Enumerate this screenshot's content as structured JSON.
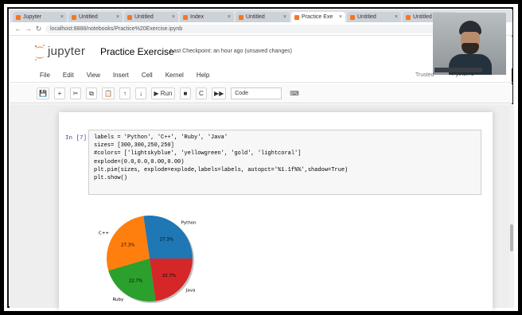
{
  "browser": {
    "tabs": [
      {
        "label": "Jupyter",
        "active": false
      },
      {
        "label": "Untitled",
        "active": false
      },
      {
        "label": "Untitled",
        "active": false
      },
      {
        "label": "Index",
        "active": false
      },
      {
        "label": "Untitled",
        "active": false
      },
      {
        "label": "Practice Exe",
        "active": true
      },
      {
        "label": "Untitled",
        "active": false
      },
      {
        "label": "Untitled",
        "active": false
      }
    ],
    "new_tab": "+",
    "url": "localhost:8888/notebooks/Practice%20Exercise.ipynb"
  },
  "jupyter": {
    "logo_text": "jupyter",
    "notebook_title": "Practice Exercise",
    "checkpoint": "Last Checkpoint: an hour ago  (unsaved changes)",
    "menu": [
      "File",
      "Edit",
      "View",
      "Insert",
      "Cell",
      "Kernel",
      "Help"
    ],
    "trusted": "Trusted",
    "kernel": "Python 3",
    "toolbar": {
      "save": "💾",
      "add": "+",
      "cut": "✂",
      "copy": "⧉",
      "paste": "📋",
      "up": "↑",
      "down": "↓",
      "run": "▶ Run",
      "stop": "■",
      "restart": "C",
      "fast_forward": "▶▶",
      "cell_type": "Code",
      "keyboard": "⌨"
    }
  },
  "cell": {
    "prompt": "In [7]:",
    "code_lines": [
      "labels = 'Python', 'C++', 'Ruby', 'Java'",
      "sizes= [300,300,250,250]",
      "#colors= ['lightskyblue', 'yellowgreen', 'gold', 'lightcoral']",
      "explode=(0.0,0.0,0.00,0.00)",
      "plt.pie(sizes, explode=explode,labels=labels, autopct='%1.1f%%',shadow=True)",
      "plt.show()"
    ]
  },
  "chart_data": {
    "type": "pie",
    "labels": [
      "Python",
      "C++",
      "Ruby",
      "Java"
    ],
    "values": [
      300,
      300,
      250,
      250
    ],
    "percent_labels": [
      "27.3%",
      "27.3%",
      "22.7%",
      "22.7%"
    ],
    "colors": [
      "#1f77b4",
      "#ff7f0e",
      "#2ca02c",
      "#d62728"
    ],
    "start_angle_deg": 0,
    "direction": "counterclockwise"
  },
  "webcam": {
    "name_tag": ""
  }
}
